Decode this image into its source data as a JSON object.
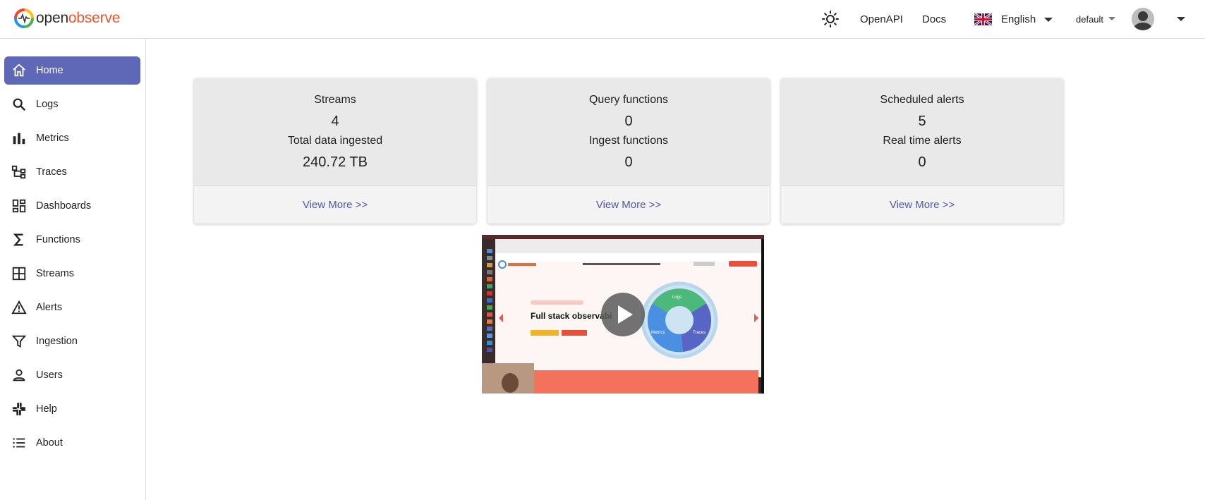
{
  "logo": {
    "part1": "open",
    "part2": "observe"
  },
  "header": {
    "theme_icon": "sun-icon",
    "openapi": "OpenAPI",
    "docs": "Docs",
    "language": "English",
    "org": "default"
  },
  "sidebar": {
    "items": [
      {
        "label": "Home",
        "icon": "home-icon",
        "active": true
      },
      {
        "label": "Logs",
        "icon": "search-icon"
      },
      {
        "label": "Metrics",
        "icon": "bar-chart-icon"
      },
      {
        "label": "Traces",
        "icon": "hierarchy-icon"
      },
      {
        "label": "Dashboards",
        "icon": "dashboard-icon"
      },
      {
        "label": "Functions",
        "icon": "sigma-icon"
      },
      {
        "label": "Streams",
        "icon": "table-icon"
      },
      {
        "label": "Alerts",
        "icon": "warning-icon"
      },
      {
        "label": "Ingestion",
        "icon": "filter-icon"
      },
      {
        "label": "Users",
        "icon": "user-icon"
      },
      {
        "label": "Help",
        "icon": "slack-icon"
      },
      {
        "label": "About",
        "icon": "list-icon"
      }
    ]
  },
  "cards": [
    {
      "label1": "Streams",
      "value1": "4",
      "label2": "Total data ingested",
      "value2": "240.72 TB",
      "link": "View More >>"
    },
    {
      "label1": "Query functions",
      "value1": "0",
      "label2": "Ingest functions",
      "value2": "0",
      "link": "View More >>"
    },
    {
      "label1": "Scheduled alerts",
      "value1": "5",
      "label2": "Real time alerts",
      "value2": "0",
      "link": "View More >>"
    }
  ],
  "video": {
    "headline": "Full stack observabi",
    "segments": [
      "Logs",
      "Metrics",
      "Traces"
    ]
  },
  "colors": {
    "accent": "#5f67b7",
    "link": "#5058a8",
    "brand_orange": "#f0542d"
  }
}
